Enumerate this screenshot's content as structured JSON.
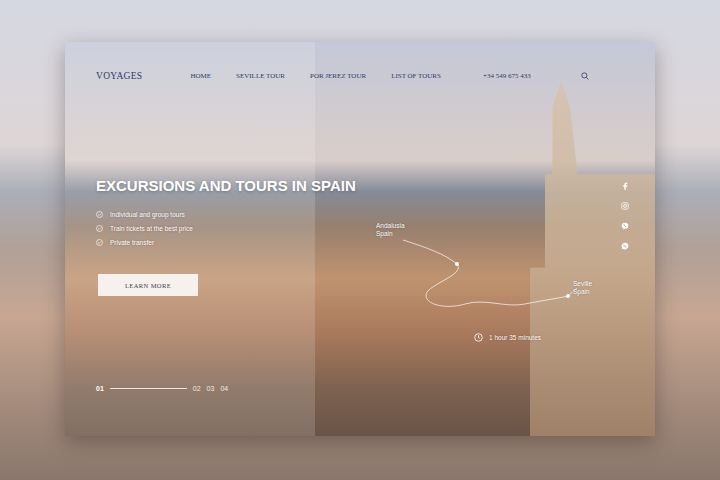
{
  "nav": {
    "logo": "VOYAGES",
    "links": [
      "HOME",
      "SEVILLE TOUR",
      "POR JEREZ TOUR",
      "LIST OF TOURS"
    ],
    "phone": "+34 549 675 433"
  },
  "hero": {
    "title": "EXCURSIONS AND TOURS IN SPAIN",
    "features": [
      "Individual and group tours",
      "Train tickets at the best price",
      "Private transfer"
    ],
    "button": "LEARN MORE"
  },
  "route": {
    "from": [
      "Andalusia",
      "Spain"
    ],
    "to": [
      "Seville",
      "Spain"
    ],
    "duration": "1 hour 35 minutes"
  },
  "slides": [
    {
      "label": "01",
      "selected": true
    },
    {
      "label": "02",
      "selected": false
    },
    {
      "label": "03",
      "selected": false
    },
    {
      "label": "04",
      "selected": false
    }
  ]
}
